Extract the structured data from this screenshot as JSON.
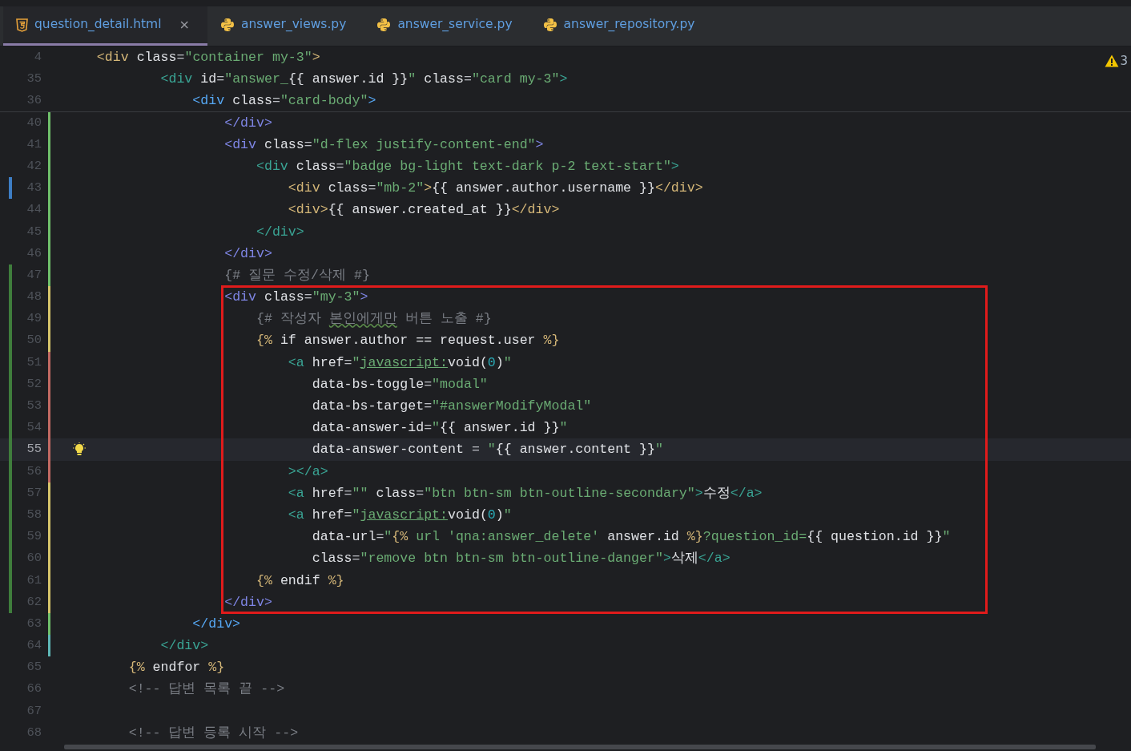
{
  "tabs": [
    {
      "label": "question_detail.html",
      "kind": "html",
      "selected": true,
      "close": "×"
    },
    {
      "label": "answer_views.py",
      "kind": "python",
      "selected": false
    },
    {
      "label": "answer_service.py",
      "kind": "python",
      "selected": false
    },
    {
      "label": "answer_repository.py",
      "kind": "python",
      "selected": false
    }
  ],
  "inspections": {
    "warnings": "3"
  },
  "sticky_lines": [
    {
      "number": "4",
      "tokens": [
        {
          "text": "    <div",
          "kind": "tag",
          "color": "#d5b778"
        },
        {
          "text": " class",
          "kind": "attr"
        },
        {
          "text": "=",
          "kind": "op"
        },
        {
          "text": "\"container my-3\"",
          "kind": "str"
        },
        {
          "text": ">",
          "kind": "tag",
          "color": "#d5b778"
        }
      ]
    },
    {
      "number": "35",
      "tokens": [
        {
          "text": "            <div",
          "kind": "tag",
          "color": "#3aa595"
        },
        {
          "text": " id",
          "kind": "attr"
        },
        {
          "text": "=",
          "kind": "op"
        },
        {
          "text": "\"answer_",
          "kind": "str"
        },
        {
          "text": "{{ answer.id }}",
          "kind": "txt"
        },
        {
          "text": "\"",
          "kind": "str"
        },
        {
          "text": " class",
          "kind": "attr"
        },
        {
          "text": "=",
          "kind": "op"
        },
        {
          "text": "\"card my-3\"",
          "kind": "str"
        },
        {
          "text": ">",
          "kind": "tag",
          "color": "#3aa595"
        }
      ]
    },
    {
      "number": "36",
      "tokens": [
        {
          "text": "                <div",
          "kind": "tag",
          "color": "#56a8f5"
        },
        {
          "text": " class",
          "kind": "attr"
        },
        {
          "text": "=",
          "kind": "op"
        },
        {
          "text": "\"card-body\"",
          "kind": "str"
        },
        {
          "text": ">",
          "kind": "tag",
          "color": "#56a8f5"
        }
      ]
    }
  ],
  "lines": [
    {
      "number": "40",
      "current": false,
      "stripe": {
        "color": "#6fc06b"
      },
      "tokens": [
        {
          "text": "                    </div>",
          "kind": "tag",
          "color": "#7f86e6"
        }
      ]
    },
    {
      "number": "41",
      "current": false,
      "stripe": {
        "color": "#6fc06b"
      },
      "tokens": [
        {
          "text": "                    <div",
          "kind": "tag",
          "color": "#7f86e6"
        },
        {
          "text": " class",
          "kind": "attr"
        },
        {
          "text": "=",
          "kind": "op"
        },
        {
          "text": "\"d-flex justify-content-end\"",
          "kind": "str"
        },
        {
          "text": ">",
          "kind": "tag",
          "color": "#7f86e6"
        }
      ]
    },
    {
      "number": "42",
      "current": false,
      "stripe": {
        "color": "#6fc06b"
      },
      "tokens": [
        {
          "text": "                        <div",
          "kind": "tag",
          "color": "#3aa595"
        },
        {
          "text": " class",
          "kind": "attr"
        },
        {
          "text": "=",
          "kind": "op"
        },
        {
          "text": "\"badge bg-light text-dark p-2 text-start\"",
          "kind": "str"
        },
        {
          "text": ">",
          "kind": "tag",
          "color": "#3aa595"
        }
      ]
    },
    {
      "number": "43",
      "current": false,
      "stripe": {
        "color": "#6fc06b"
      },
      "marker": {
        "color": "#3d7dc4"
      },
      "tokens": [
        {
          "text": "                            <div",
          "kind": "tag",
          "color": "#d5b778"
        },
        {
          "text": " class",
          "kind": "attr"
        },
        {
          "text": "=",
          "kind": "op"
        },
        {
          "text": "\"mb-2\"",
          "kind": "str"
        },
        {
          "text": ">",
          "kind": "tag",
          "color": "#d5b778"
        },
        {
          "text": "{{ answer.author.username }}",
          "kind": "txt"
        },
        {
          "text": "</div>",
          "kind": "tag",
          "color": "#d5b778"
        }
      ]
    },
    {
      "number": "44",
      "current": false,
      "stripe": {
        "color": "#6fc06b"
      },
      "tokens": [
        {
          "text": "                            <div>",
          "kind": "tag",
          "color": "#d5b778"
        },
        {
          "text": "{{ answer.created_at }}",
          "kind": "txt"
        },
        {
          "text": "</div>",
          "kind": "tag",
          "color": "#d5b778"
        }
      ]
    },
    {
      "number": "45",
      "current": false,
      "stripe": {
        "color": "#6fc06b"
      },
      "tokens": [
        {
          "text": "                        </div>",
          "kind": "tag",
          "color": "#3aa595"
        }
      ]
    },
    {
      "number": "46",
      "current": false,
      "stripe": {
        "color": "#6fc06b"
      },
      "tokens": [
        {
          "text": "                    </div>",
          "kind": "tag",
          "color": "#7f86e6"
        }
      ]
    },
    {
      "number": "47",
      "current": false,
      "stripe": {
        "color": "#6fc06b"
      },
      "marker": {
        "color": "#3f7d3c"
      },
      "tokens": [
        {
          "text": "                    {# 질문 수정/삭제 #}",
          "kind": "cmt"
        }
      ]
    },
    {
      "number": "48",
      "current": false,
      "stripe": {
        "color": "#d6c46a"
      },
      "marker": {
        "color": "#3f7d3c"
      },
      "tokens": [
        {
          "text": "                    <div",
          "kind": "tag",
          "color": "#7f86e6"
        },
        {
          "text": " class",
          "kind": "attr"
        },
        {
          "text": "=",
          "kind": "op"
        },
        {
          "text": "\"my-3\"",
          "kind": "str"
        },
        {
          "text": ">",
          "kind": "tag",
          "color": "#7f86e6"
        }
      ]
    },
    {
      "number": "49",
      "current": false,
      "stripe": {
        "color": "#d6c46a"
      },
      "marker": {
        "color": "#3f7d3c"
      },
      "tokens": [
        {
          "text": "                        {# 작성자 ",
          "kind": "cmt"
        },
        {
          "text": "본인에게만",
          "kind": "typo"
        },
        {
          "text": " 버튼 노출 #}",
          "kind": "cmt"
        }
      ]
    },
    {
      "number": "50",
      "current": false,
      "stripe": {
        "color": "#d6c46a"
      },
      "marker": {
        "color": "#3f7d3c"
      },
      "tokens": [
        {
          "text": "                        {%",
          "kind": "tpl"
        },
        {
          "text": " if answer.author == request.user ",
          "kind": "txt"
        },
        {
          "text": "%}",
          "kind": "tpl"
        }
      ]
    },
    {
      "number": "51",
      "current": false,
      "stripe": {
        "color": "#c26a63"
      },
      "marker": {
        "color": "#3f7d3c"
      },
      "tokens": [
        {
          "text": "                            <a",
          "kind": "tag",
          "color": "#3aa595"
        },
        {
          "text": " href",
          "kind": "attr"
        },
        {
          "text": "=",
          "kind": "op"
        },
        {
          "text": "\"",
          "kind": "str"
        },
        {
          "text": "javascript:",
          "kind": "link"
        },
        {
          "text": "void(",
          "kind": "txt"
        },
        {
          "text": "0",
          "kind": "num"
        },
        {
          "text": ")",
          "kind": "txt"
        },
        {
          "text": "\"",
          "kind": "str"
        }
      ]
    },
    {
      "number": "52",
      "current": false,
      "stripe": {
        "color": "#c26a63"
      },
      "marker": {
        "color": "#3f7d3c"
      },
      "tokens": [
        {
          "text": "                               data-bs-toggle",
          "kind": "attr"
        },
        {
          "text": "=",
          "kind": "op"
        },
        {
          "text": "\"modal\"",
          "kind": "str"
        }
      ]
    },
    {
      "number": "53",
      "current": false,
      "stripe": {
        "color": "#c26a63"
      },
      "marker": {
        "color": "#3f7d3c"
      },
      "tokens": [
        {
          "text": "                               data-bs-target",
          "kind": "attr"
        },
        {
          "text": "=",
          "kind": "op"
        },
        {
          "text": "\"#answerModifyModal\"",
          "kind": "str"
        }
      ]
    },
    {
      "number": "54",
      "current": false,
      "stripe": {
        "color": "#c26a63"
      },
      "marker": {
        "color": "#3f7d3c"
      },
      "tokens": [
        {
          "text": "                               data-answer-id",
          "kind": "attr"
        },
        {
          "text": "=",
          "kind": "op"
        },
        {
          "text": "\"",
          "kind": "str"
        },
        {
          "text": "{{ answer.id }}",
          "kind": "txt"
        },
        {
          "text": "\"",
          "kind": "str"
        }
      ]
    },
    {
      "number": "55",
      "current": true,
      "stripe": {
        "color": "#c26a63"
      },
      "marker": {
        "color": "#3f7d3c"
      },
      "tokens": [
        {
          "text": "                               data-answer-content",
          "kind": "attr"
        },
        {
          "text": " = ",
          "kind": "op"
        },
        {
          "text": "\"",
          "kind": "str"
        },
        {
          "text": "{{ answer.content }}",
          "kind": "txt"
        },
        {
          "text": "\"",
          "kind": "str"
        }
      ]
    },
    {
      "number": "56",
      "current": false,
      "stripe": {
        "color": "#c26a63"
      },
      "marker": {
        "color": "#3f7d3c"
      },
      "tokens": [
        {
          "text": "                            ></a>",
          "kind": "tag",
          "color": "#3aa595"
        }
      ]
    },
    {
      "number": "57",
      "current": false,
      "stripe": {
        "color": "#d6c46a"
      },
      "marker": {
        "color": "#3f7d3c"
      },
      "tokens": [
        {
          "text": "                            <a",
          "kind": "tag",
          "color": "#3aa595"
        },
        {
          "text": " href",
          "kind": "attr"
        },
        {
          "text": "=",
          "kind": "op"
        },
        {
          "text": "\"\"",
          "kind": "str"
        },
        {
          "text": " class",
          "kind": "attr"
        },
        {
          "text": "=",
          "kind": "op"
        },
        {
          "text": "\"btn btn-sm btn-outline-secondary\"",
          "kind": "str"
        },
        {
          "text": ">",
          "kind": "tag",
          "color": "#3aa595"
        },
        {
          "text": "수정",
          "kind": "txt"
        },
        {
          "text": "</a>",
          "kind": "tag",
          "color": "#3aa595"
        }
      ]
    },
    {
      "number": "58",
      "current": false,
      "stripe": {
        "color": "#d6c46a"
      },
      "marker": {
        "color": "#3f7d3c"
      },
      "tokens": [
        {
          "text": "                            <a",
          "kind": "tag",
          "color": "#3aa595"
        },
        {
          "text": " href",
          "kind": "attr"
        },
        {
          "text": "=",
          "kind": "op"
        },
        {
          "text": "\"",
          "kind": "str"
        },
        {
          "text": "javascript:",
          "kind": "link"
        },
        {
          "text": "void(",
          "kind": "txt"
        },
        {
          "text": "0",
          "kind": "num"
        },
        {
          "text": ")",
          "kind": "txt"
        },
        {
          "text": "\"",
          "kind": "str"
        }
      ]
    },
    {
      "number": "59",
      "current": false,
      "stripe": {
        "color": "#d6c46a"
      },
      "marker": {
        "color": "#3f7d3c"
      },
      "tokens": [
        {
          "text": "                               data-url",
          "kind": "attr"
        },
        {
          "text": "=",
          "kind": "op"
        },
        {
          "text": "\"",
          "kind": "str"
        },
        {
          "text": "{%",
          "kind": "tpl"
        },
        {
          "text": " url 'qna:answer_delete'",
          "kind": "str"
        },
        {
          "text": " answer.id ",
          "kind": "txt"
        },
        {
          "text": "%}",
          "kind": "tpl"
        },
        {
          "text": "?question_id=",
          "kind": "str"
        },
        {
          "text": "{{ question.id }}",
          "kind": "txt"
        },
        {
          "text": "\"",
          "kind": "str"
        }
      ]
    },
    {
      "number": "60",
      "current": false,
      "stripe": {
        "color": "#d6c46a"
      },
      "marker": {
        "color": "#3f7d3c"
      },
      "tokens": [
        {
          "text": "                               class",
          "kind": "attr"
        },
        {
          "text": "=",
          "kind": "op"
        },
        {
          "text": "\"remove btn btn-sm btn-outline-danger\"",
          "kind": "str"
        },
        {
          "text": ">",
          "kind": "tag",
          "color": "#3aa595"
        },
        {
          "text": "삭제",
          "kind": "txt"
        },
        {
          "text": "</a>",
          "kind": "tag",
          "color": "#3aa595"
        }
      ]
    },
    {
      "number": "61",
      "current": false,
      "stripe": {
        "color": "#d6c46a"
      },
      "marker": {
        "color": "#3f7d3c"
      },
      "tokens": [
        {
          "text": "                        {%",
          "kind": "tpl"
        },
        {
          "text": " endif ",
          "kind": "txt"
        },
        {
          "text": "%}",
          "kind": "tpl"
        }
      ]
    },
    {
      "number": "62",
      "current": false,
      "stripe": {
        "color": "#d6c46a"
      },
      "marker": {
        "color": "#3f7d3c"
      },
      "tokens": [
        {
          "text": "                    </div>",
          "kind": "tag",
          "color": "#7f86e6"
        }
      ]
    },
    {
      "number": "63",
      "current": false,
      "stripe": {
        "color": "#6fc06b"
      },
      "tokens": [
        {
          "text": "                </div>",
          "kind": "tag",
          "color": "#56a8f5"
        }
      ]
    },
    {
      "number": "64",
      "current": false,
      "stripe": {
        "color": "#5fb8b8"
      },
      "tokens": [
        {
          "text": "            </div>",
          "kind": "tag",
          "color": "#3aa595"
        }
      ]
    },
    {
      "number": "65",
      "current": false,
      "tokens": [
        {
          "text": "        {%",
          "kind": "tpl"
        },
        {
          "text": " endfor ",
          "kind": "txt"
        },
        {
          "text": "%}",
          "kind": "tpl"
        }
      ]
    },
    {
      "number": "66",
      "current": false,
      "tokens": [
        {
          "text": "        <!-- 답변 목록 끝 -->",
          "kind": "cmt"
        }
      ]
    },
    {
      "number": "67",
      "current": false
    },
    {
      "number": "68",
      "current": false,
      "tokens": [
        {
          "text": "        <!-- 답변 등록 시작 -->",
          "kind": "cmt"
        }
      ]
    }
  ],
  "annotation": {
    "kind": "rectangle",
    "color": "#e01b1b"
  }
}
